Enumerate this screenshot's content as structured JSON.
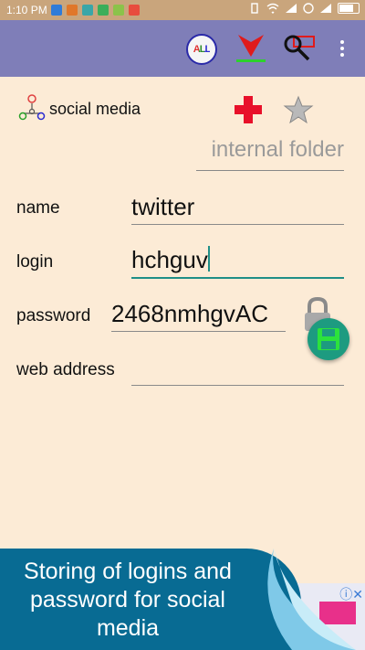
{
  "status": {
    "time": "1:10 PM"
  },
  "toolbar": {
    "all_label": "ALL"
  },
  "category": {
    "label": "social media"
  },
  "folder": {
    "text": "internal folder"
  },
  "form": {
    "name_label": "name",
    "name_value": "twitter",
    "login_label": "login",
    "login_value": "hchguv",
    "password_label": "password",
    "password_value": "2468nmhgvAC",
    "web_label": "web address",
    "web_value": ""
  },
  "banner": {
    "text": "Storing of logins and password for social media"
  },
  "colors": {
    "toolbar": "#7f7eb8",
    "background": "#fcebd6",
    "accent": "#1f8f87",
    "save": "#1d9b80",
    "banner": "#086b93"
  }
}
